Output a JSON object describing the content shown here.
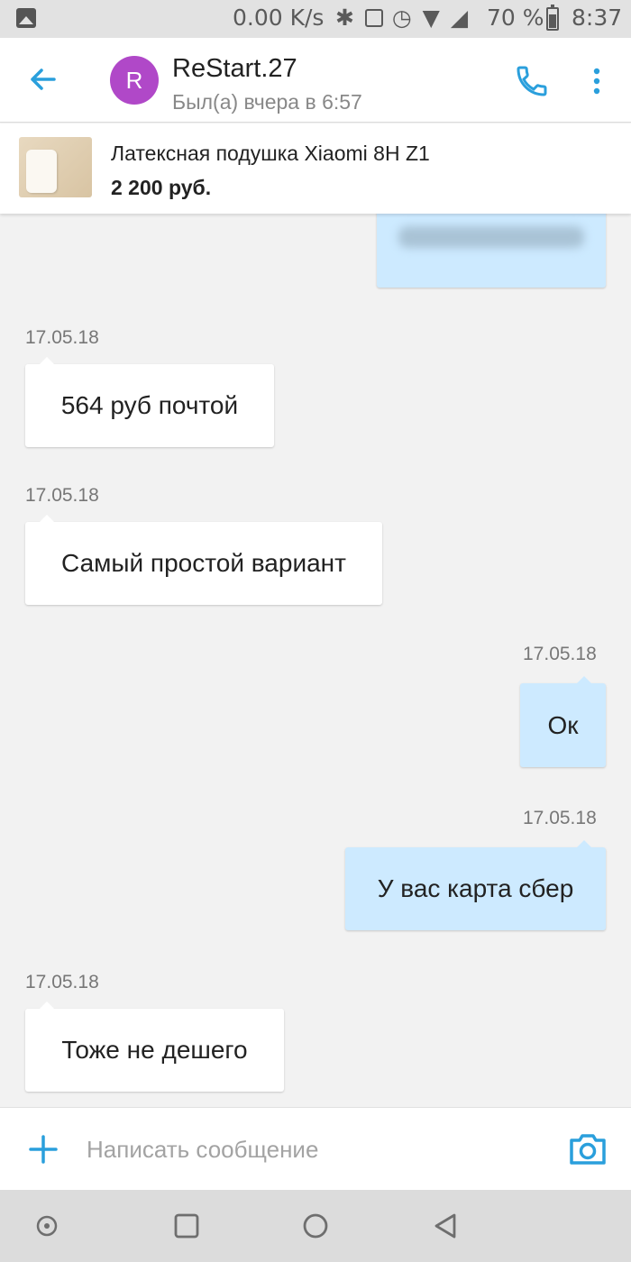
{
  "status_bar": {
    "net_speed": "0.00 K/s",
    "battery_text": "70 %",
    "time": "8:37",
    "icons": [
      "image-icon",
      "bluetooth-icon",
      "nfc-icon",
      "alarm-icon",
      "wifi-icon",
      "signal-icon",
      "battery-icon"
    ]
  },
  "header": {
    "avatar_letter": "R",
    "contact_name": "ReStart.27",
    "contact_status": "Был(а) вчера в 6:57",
    "accent_color": "#2a9fdc",
    "avatar_color": "#b048c8"
  },
  "product": {
    "title": "Латексная подушка Xiaomi 8H Z1",
    "price": "2 200 руб."
  },
  "messages": [
    {
      "direction": "out",
      "text": "",
      "date": "",
      "blurred": true
    },
    {
      "direction": "in",
      "text": "564 руб почтой",
      "date": "17.05.18"
    },
    {
      "direction": "in",
      "text": "Самый простой вариант",
      "date": "17.05.18"
    },
    {
      "direction": "out",
      "text": "Ок",
      "date": "17.05.18"
    },
    {
      "direction": "out",
      "text": "У вас карта сбер",
      "date": "17.05.18"
    },
    {
      "direction": "in",
      "text": "Тоже не дешего",
      "date": "17.05.18"
    }
  ],
  "composer": {
    "placeholder": "Написать сообщение"
  },
  "colors": {
    "incoming_bubble": "#ffffff",
    "outgoing_bubble": "#cdeaff",
    "chat_background": "#f2f2f2"
  }
}
